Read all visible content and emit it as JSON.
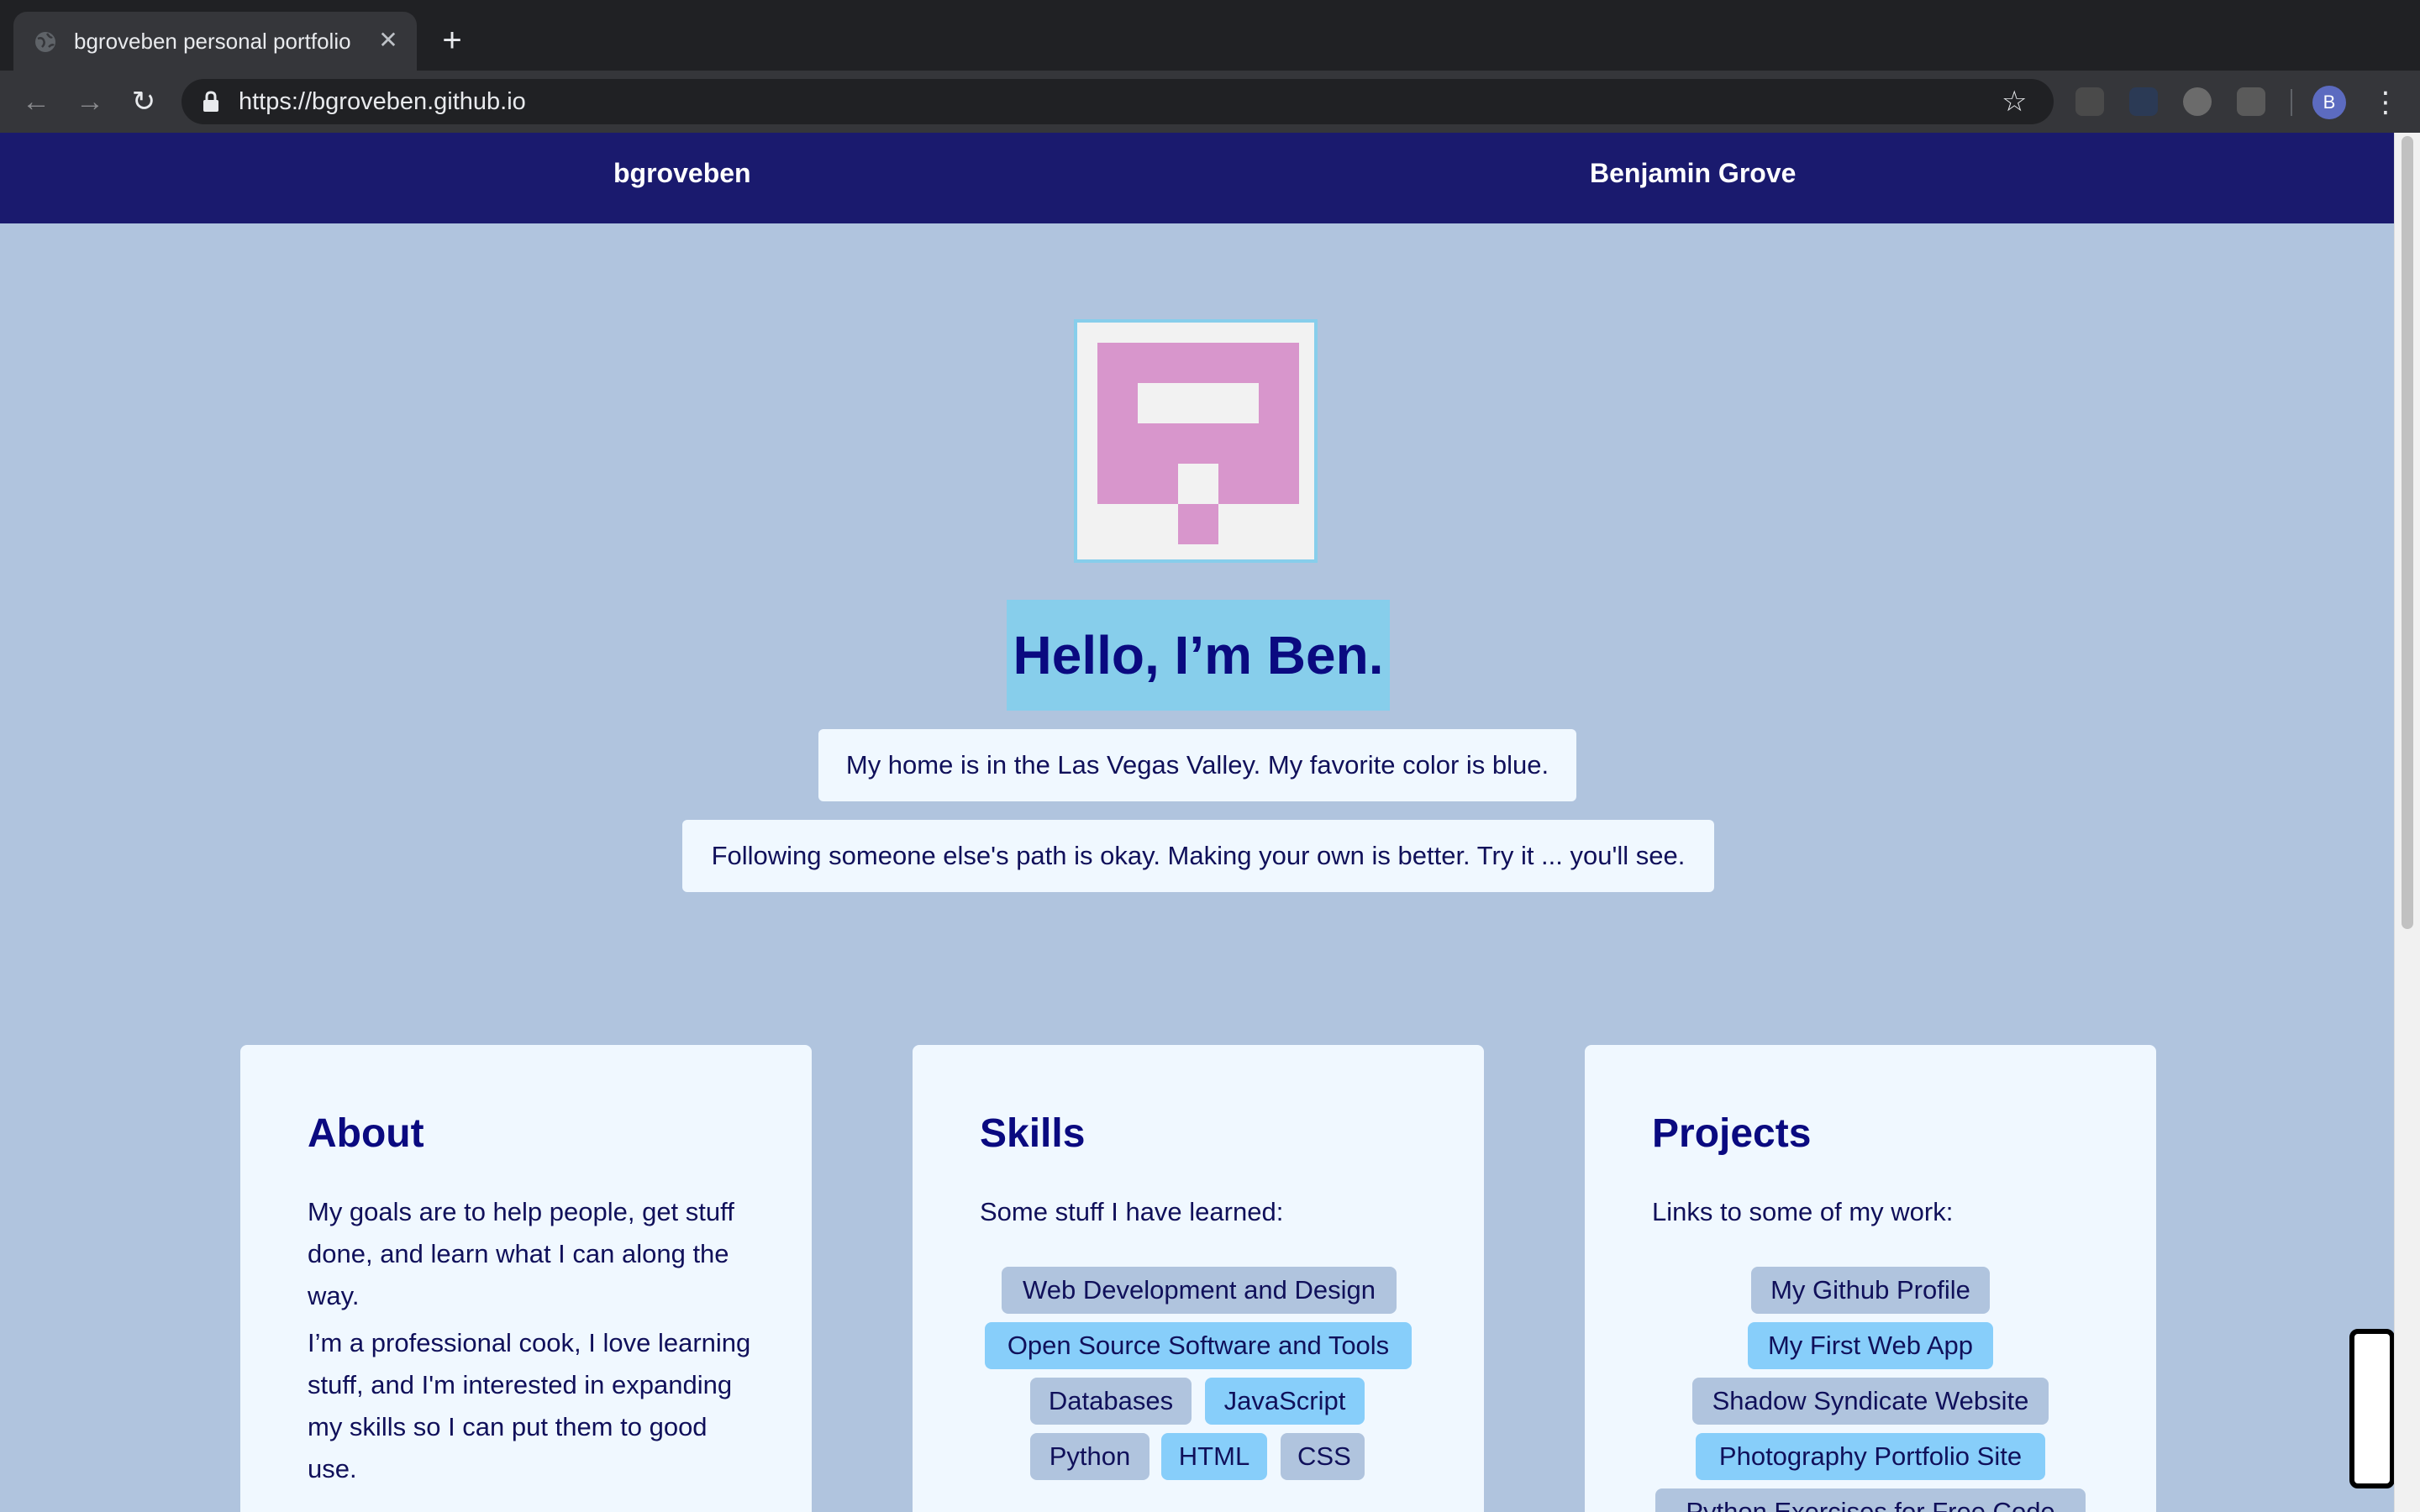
{
  "browser": {
    "tab_title": "bgroveben personal portfolio",
    "tab_close": "✕",
    "new_tab": "+",
    "url": "https://bgroveben.github.io",
    "avatar_letter": "B",
    "back": "←",
    "forward": "→",
    "reload": "↻",
    "star": "☆",
    "menu": "⋮"
  },
  "nav": {
    "left_link": "bgroveben",
    "right_link": "Benjamin Grove"
  },
  "hero": {
    "title": "Hello, I’m Ben.",
    "line1": "My home is in the Las Vegas Valley. My favorite color is blue.",
    "line2": "Following someone else's path is okay. Making your own is better. Try it ... you'll see."
  },
  "about": {
    "title": "About",
    "p1": "My goals are to help people, get stuff done, and learn what I can along the way.",
    "p2": "I’m a professional cook, I love learning stuff, and I'm interested in expanding my skills so I can put them to good use."
  },
  "skills": {
    "title": "Skills",
    "intro": "Some stuff I have learned:",
    "items": [
      "Web Development and Design",
      "Open Source Software and Tools",
      "Databases",
      "JavaScript",
      "Python",
      "HTML",
      "CSS"
    ]
  },
  "projects": {
    "title": "Projects",
    "intro": "Links to some of my work:",
    "items": [
      "My Github Profile",
      "My First Web App",
      "Shadow Syndicate Website",
      "Photography Portfolio Site",
      "Python Exercises for Free Code"
    ]
  },
  "colors": {
    "page_bg": "#b0c4de",
    "nav_bg": "#1a1a6e",
    "accent": "#87ceeb",
    "card_bg": "#f0f8ff",
    "logo_pink": "#d896cc",
    "heading": "#0a0a80"
  },
  "icons": {
    "favicon": "globe-icon",
    "lock": "lock-icon",
    "star": "star-icon",
    "menu": "kebab-menu-icon"
  }
}
